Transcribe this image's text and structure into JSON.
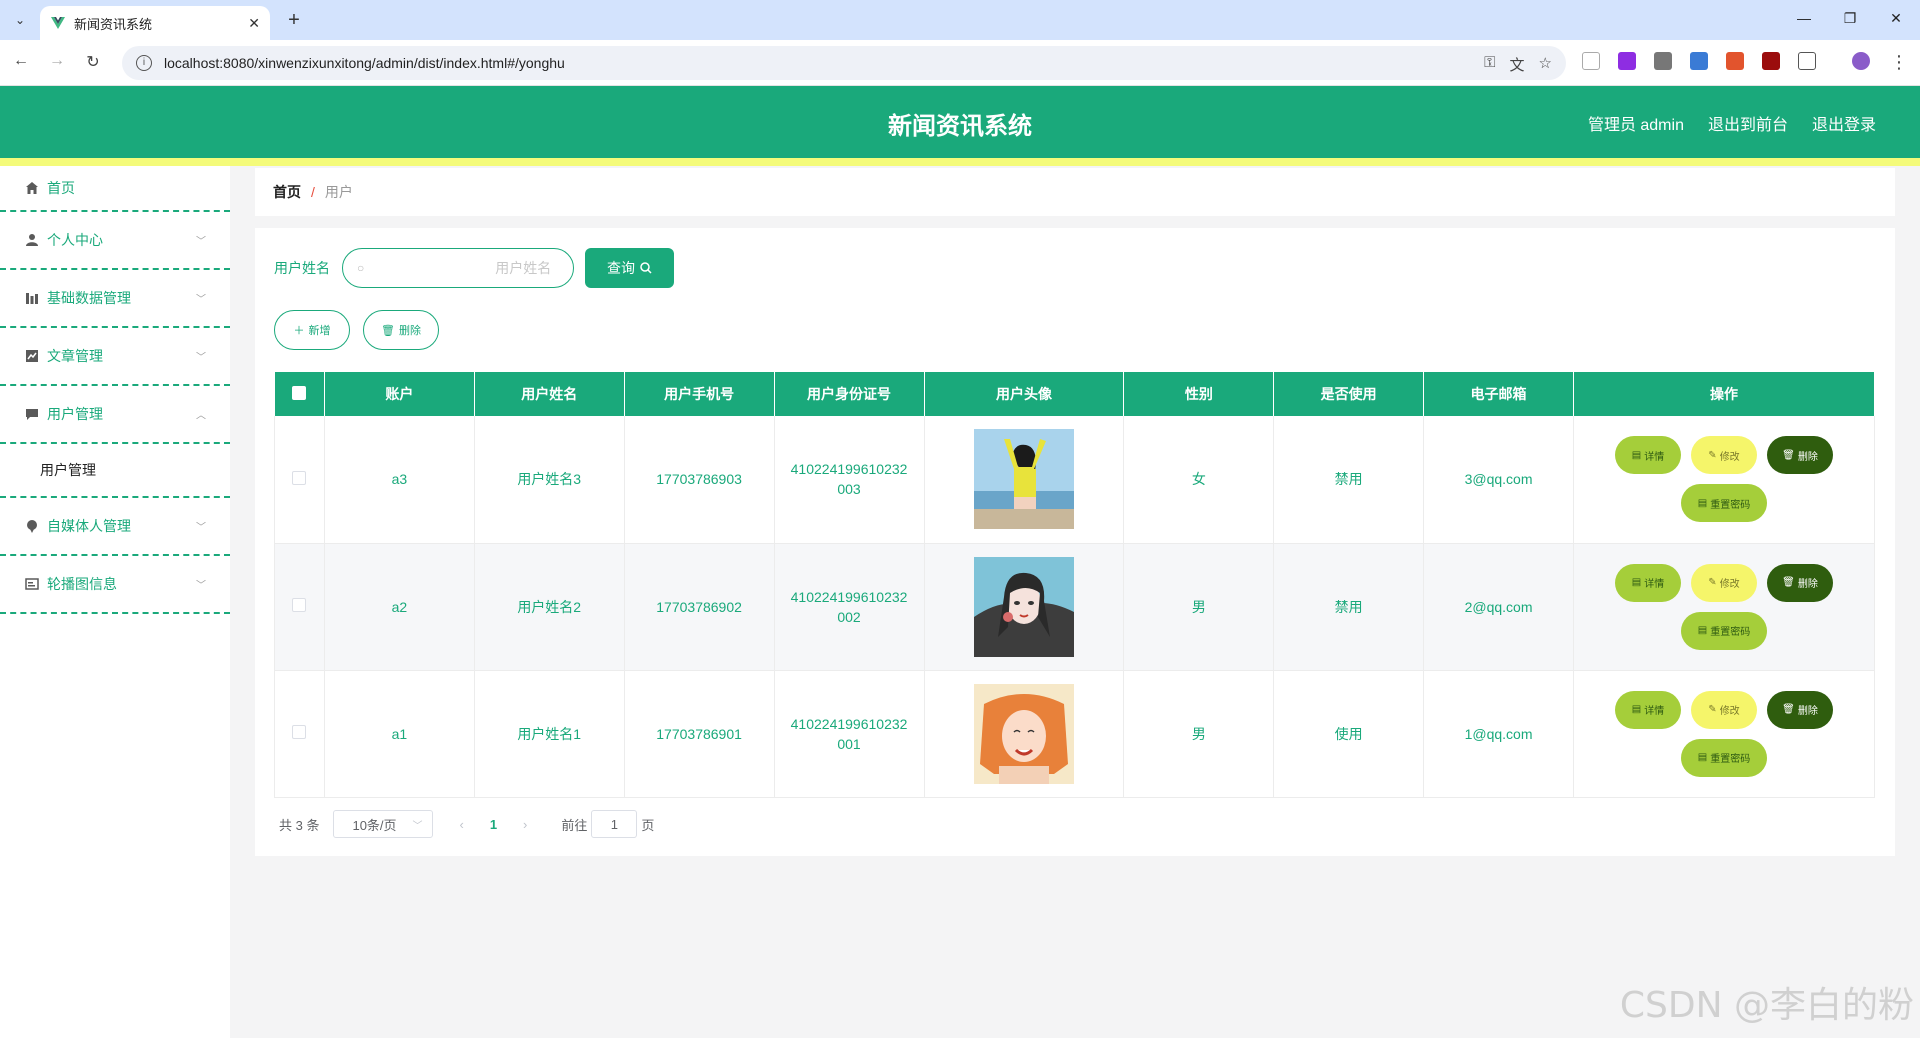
{
  "browser": {
    "tab_title": "新闻资讯系统",
    "url": "localhost:8080/xinwenzixunxitong/admin/dist/index.html#/yonghu"
  },
  "header": {
    "title": "新闻资讯系统",
    "admin_label": "管理员 admin",
    "to_front": "退出到前台",
    "logout": "退出登录"
  },
  "sidebar": {
    "items": [
      {
        "label": "首页",
        "icon": "home-icon"
      },
      {
        "label": "个人中心",
        "icon": "user-icon"
      },
      {
        "label": "基础数据管理",
        "icon": "bar-chart-icon"
      },
      {
        "label": "文章管理",
        "icon": "line-chart-icon"
      },
      {
        "label": "用户管理",
        "icon": "chat-icon"
      },
      {
        "label": "自媒体人管理",
        "icon": "pin-icon"
      },
      {
        "label": "轮播图信息",
        "icon": "image-icon"
      }
    ],
    "sub_item": "用户管理"
  },
  "breadcrumb": {
    "home": "首页",
    "separator": "/",
    "current": "用户"
  },
  "search": {
    "label": "用户姓名",
    "placeholder": "用户姓名",
    "query_button": "查询"
  },
  "actions": {
    "add": "新增",
    "delete": "删除"
  },
  "table": {
    "headers": [
      "账户",
      "用户姓名",
      "用户手机号",
      "用户身份证号",
      "用户头像",
      "性别",
      "是否使用",
      "电子邮箱",
      "操作"
    ],
    "rows": [
      {
        "account": "a3",
        "name": "用户姓名3",
        "phone": "17703786903",
        "id_line1": "410224199610232",
        "id_line2": "003",
        "gender": "女",
        "status": "禁用",
        "email": "3@qq.com"
      },
      {
        "account": "a2",
        "name": "用户姓名2",
        "phone": "17703786902",
        "id_line1": "410224199610232",
        "id_line2": "002",
        "gender": "男",
        "status": "禁用",
        "email": "2@qq.com"
      },
      {
        "account": "a1",
        "name": "用户姓名1",
        "phone": "17703786901",
        "id_line1": "410224199610232",
        "id_line2": "001",
        "gender": "男",
        "status": "使用",
        "email": "1@qq.com"
      }
    ],
    "op_labels": {
      "detail": "详情",
      "edit": "修改",
      "delete": "删除",
      "reset": "重置密码"
    }
  },
  "pagination": {
    "total": "共 3 条",
    "page_size": "10条/页",
    "current_page": "1",
    "goto_label": "前往",
    "goto_value": "1",
    "page_suffix": "页"
  },
  "watermark": "CSDN @李白的粉",
  "colors": {
    "primary": "#1aa97b",
    "accent_yellow": "#f4fb7a",
    "detail": "#a5ce3a",
    "edit": "#f5f56a",
    "delete": "#2f5d0e"
  }
}
